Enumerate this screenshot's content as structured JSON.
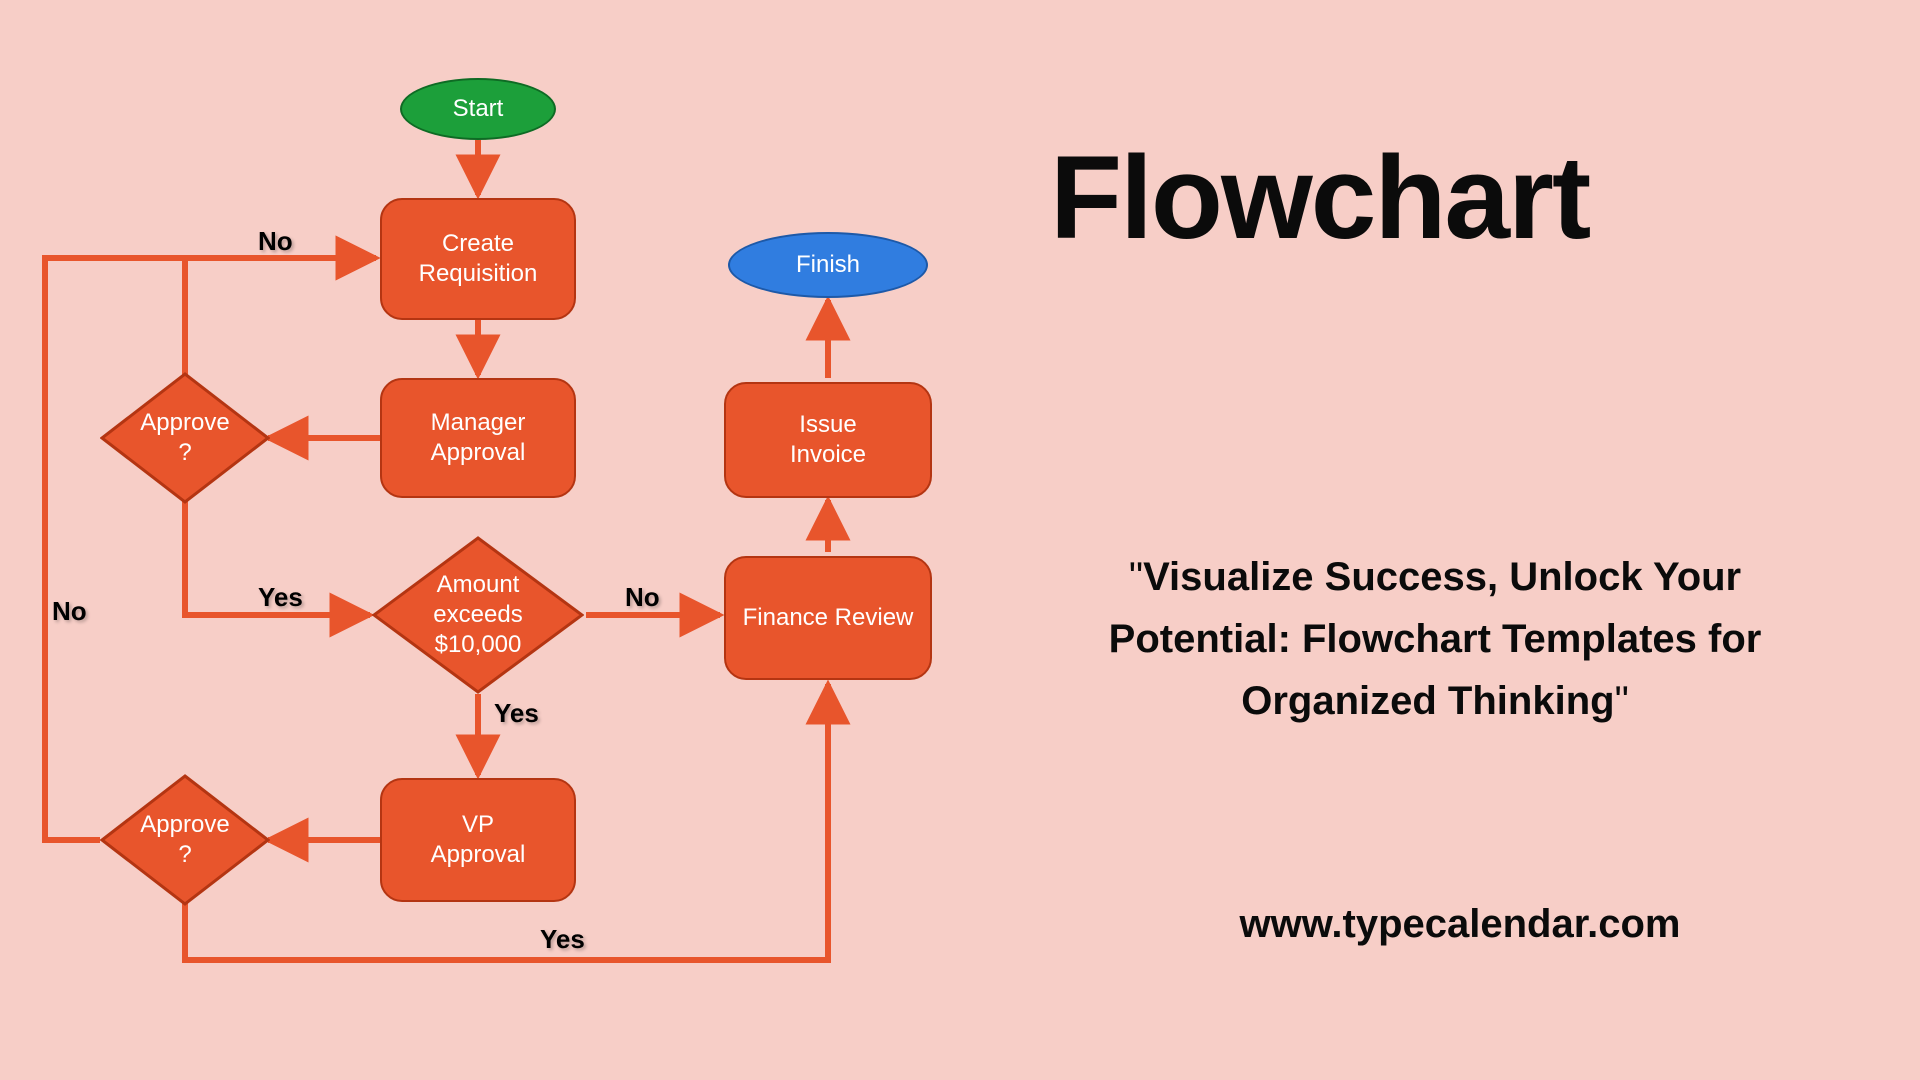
{
  "title": "Flowchart",
  "quote": "Visualize Success, Unlock Your Potential: Flowchart Templates for Organized Thinking",
  "url": "www.typecalendar.com",
  "nodes": {
    "start": "Start",
    "finish": "Finish",
    "create_req": "Create\nRequisition",
    "mgr_approval": "Manager\nApproval",
    "approve1": "Approve\n?",
    "amount": "Amount\nexceeds\n$10,000",
    "vp_approval": "VP\nApproval",
    "approve2": "Approve\n?",
    "finance": "Finance Review",
    "issue": "Issue\nInvoice"
  },
  "labels": {
    "no": "No",
    "yes": "Yes"
  }
}
